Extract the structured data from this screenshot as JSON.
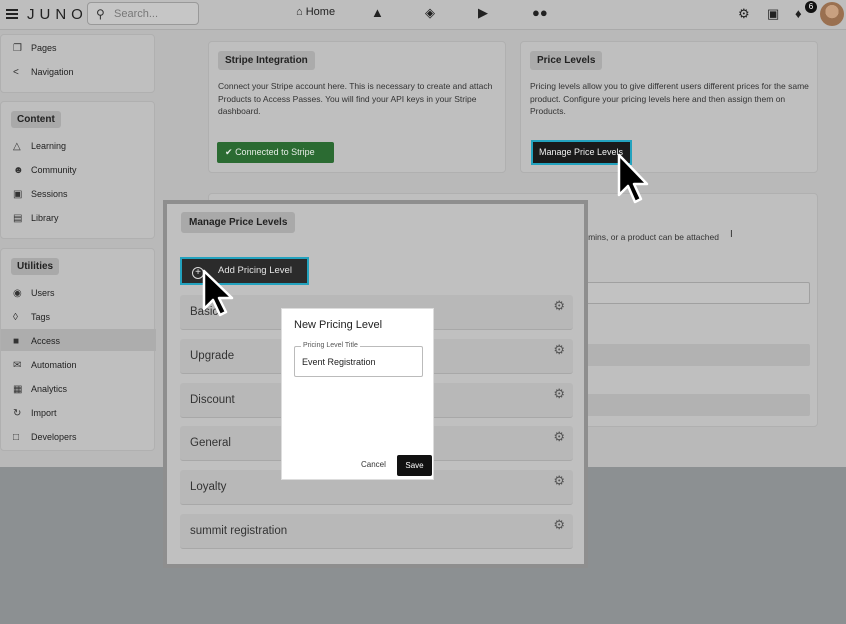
{
  "header": {
    "logo": "JUNO",
    "search_placeholder": "Search...",
    "home_label": "Home",
    "notification_count": "6"
  },
  "sidebar": {
    "group1": [
      {
        "label": "Pages",
        "icon": "pages-icon"
      },
      {
        "label": "Navigation",
        "icon": "share-icon"
      }
    ],
    "content_heading": "Content",
    "content": [
      {
        "label": "Learning",
        "icon": "graduation-cap-icon"
      },
      {
        "label": "Community",
        "icon": "people-icon"
      },
      {
        "label": "Sessions",
        "icon": "video-icon"
      },
      {
        "label": "Library",
        "icon": "library-icon"
      }
    ],
    "utilities_heading": "Utilities",
    "utilities": [
      {
        "label": "Users",
        "icon": "users-icon"
      },
      {
        "label": "Tags",
        "icon": "tag-icon"
      },
      {
        "label": "Access",
        "icon": "lock-icon"
      },
      {
        "label": "Automation",
        "icon": "mail-icon"
      },
      {
        "label": "Analytics",
        "icon": "chart-icon"
      },
      {
        "label": "Import",
        "icon": "sync-icon"
      },
      {
        "label": "Developers",
        "icon": "lock-outline-icon"
      }
    ]
  },
  "stripe_card": {
    "title": "Stripe Integration",
    "text": "Connect your Stripe account here. This is necessary to create and attach Products to Access Passes. You will find your API keys in your Stripe dashboard.",
    "button": "Connected to Stripe"
  },
  "price_card": {
    "title": "Price Levels",
    "text": "Pricing levels allow you to give different users different prices for the same product. Configure your pricing levels here and then assign them on Products.",
    "button": "Manage Price Levels"
  },
  "background_card": {
    "text": "y admins, or a product can be attached"
  },
  "panel": {
    "title": "Manage Price Levels",
    "add_button": "Add Pricing Level",
    "levels": [
      {
        "name": "Basic"
      },
      {
        "name": "Upgrade"
      },
      {
        "name": "Discount"
      },
      {
        "name": "General"
      },
      {
        "name": "Loyalty"
      },
      {
        "name": "summit registration"
      }
    ]
  },
  "modal": {
    "title": "New Pricing Level",
    "field_label": "Pricing Level Title",
    "field_value": "Event Registration",
    "cancel": "Cancel",
    "save": "Save"
  },
  "colors": {
    "accent_outline": "#23a2be",
    "stripe_green": "#2b6b32"
  }
}
